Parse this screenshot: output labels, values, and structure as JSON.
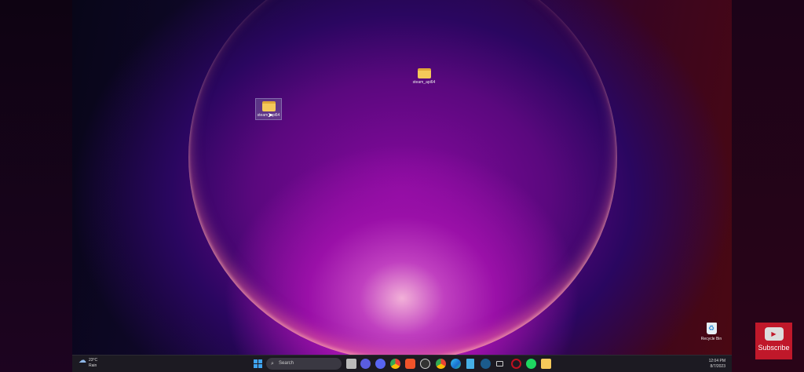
{
  "desktop": {
    "icons": [
      {
        "label": "steam_api64",
        "type": "folder"
      },
      {
        "label": "steam_api64",
        "type": "folder",
        "selected": true
      },
      {
        "label": "Recycle Bin",
        "type": "recycle-bin"
      }
    ]
  },
  "taskbar": {
    "weather": {
      "temp": "23°C",
      "condition": "Rain"
    },
    "search_placeholder": "Search",
    "apps": [
      "task-view",
      "meet",
      "discord",
      "chrome",
      "brave",
      "obs",
      "chrome",
      "edge",
      "notepad",
      "steam",
      "display",
      "opera",
      "spotify",
      "file-explorer"
    ],
    "clock": {
      "time": "12:04 PM",
      "date": "8/7/2023"
    }
  },
  "overlay": {
    "subscribe_label": "Subscribe"
  }
}
